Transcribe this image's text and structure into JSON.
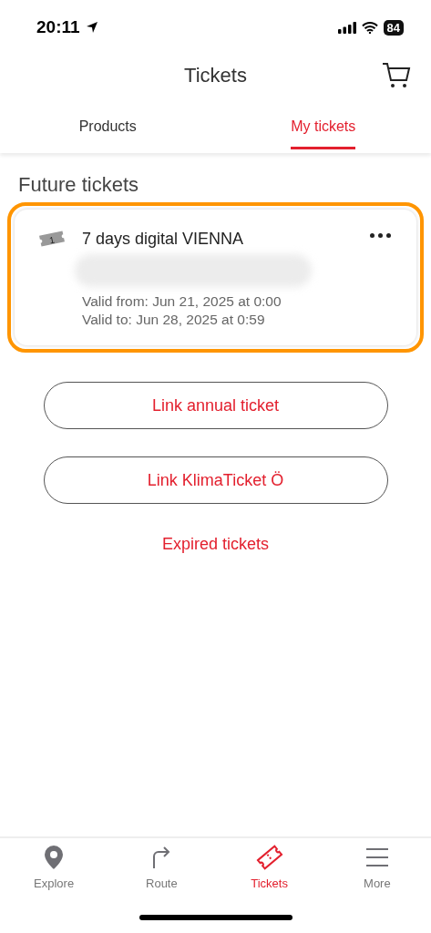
{
  "status_bar": {
    "time": "20:11",
    "battery": "84"
  },
  "header": {
    "title": "Tickets"
  },
  "tabs": [
    {
      "label": "Products",
      "selected": false
    },
    {
      "label": "My tickets",
      "selected": true
    }
  ],
  "section_title": "Future tickets",
  "tickets": [
    {
      "badge": "1",
      "name": "7 days digital VIENNA",
      "highlighted": true,
      "valid_from": "Valid from: Jun 21, 2025 at 0:00",
      "valid_to": "Valid to: Jun 28, 2025 at 0:59"
    }
  ],
  "buttons": [
    "Link annual ticket",
    "Link KlimaTicket Ö"
  ],
  "link": "Expired tickets",
  "bottom_nav": [
    {
      "kind": "explore",
      "label": "Explore",
      "selected": false
    },
    {
      "kind": "route",
      "label": "Route",
      "selected": false
    },
    {
      "kind": "tickets",
      "label": "Tickets",
      "selected": true
    },
    {
      "kind": "more",
      "label": "More",
      "selected": false
    }
  ]
}
